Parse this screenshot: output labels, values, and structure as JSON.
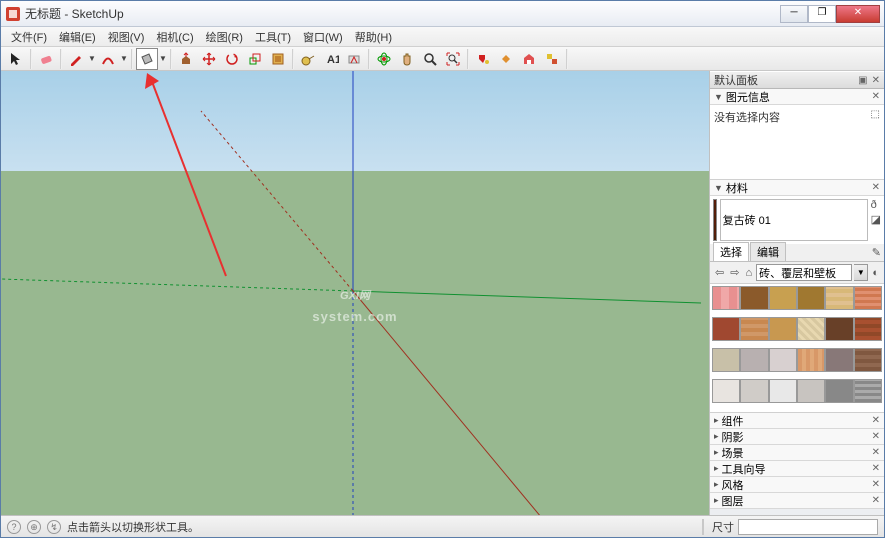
{
  "window": {
    "title": "无标题 - SketchUp"
  },
  "menu": {
    "items": [
      "文件(F)",
      "编辑(E)",
      "视图(V)",
      "相机(C)",
      "绘图(R)",
      "工具(T)",
      "窗口(W)",
      "帮助(H)"
    ]
  },
  "toolbar": {
    "groups": [
      [
        "select"
      ],
      [
        "eraser"
      ],
      [
        "pencil",
        "arc",
        "freehand"
      ],
      [
        "rectangle"
      ],
      [
        "pushpull",
        "move",
        "rotate",
        "scale",
        "offset"
      ],
      [
        "tape",
        "text",
        "protractor"
      ],
      [
        "orbit",
        "pan",
        "zoom",
        "zoom-extents"
      ],
      [
        "paint",
        "sample",
        "3dwarehouse",
        "extension"
      ]
    ]
  },
  "side": {
    "default_panel": "默认面板",
    "entity_info": {
      "title": "图元信息",
      "body": "没有选择内容"
    },
    "materials": {
      "title": "材料",
      "current_name": "复古砖 01",
      "tabs": [
        "选择",
        "编辑"
      ],
      "library": "砖、覆层和壁板"
    },
    "collapsed": [
      "组件",
      "阴影",
      "场景",
      "工具向导",
      "风格",
      "图层"
    ]
  },
  "statusbar": {
    "message": "点击箭头以切换形状工具。",
    "dim_label": "尺寸"
  },
  "watermark": {
    "main": "GXI网",
    "sub": "system.com"
  }
}
